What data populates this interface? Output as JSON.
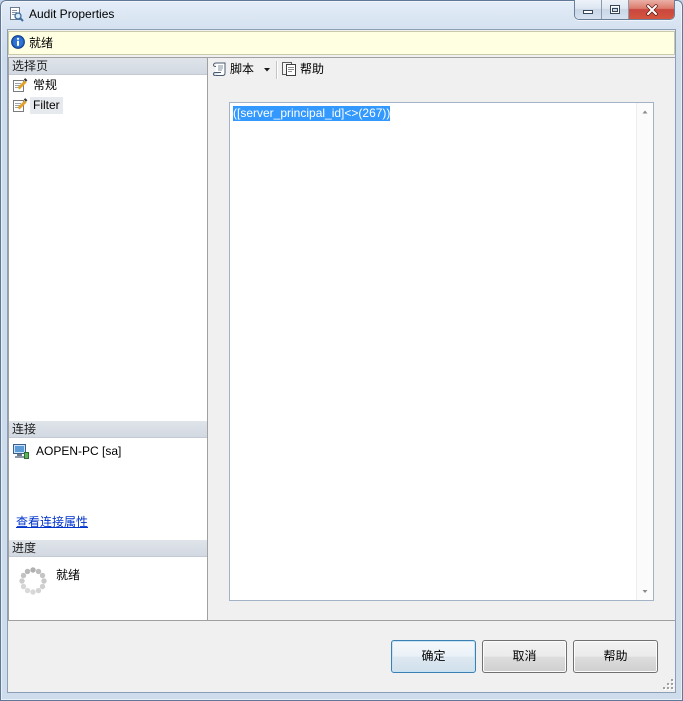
{
  "window": {
    "title": "Audit Properties",
    "icon": "audit-properties-icon",
    "controls": [
      "minimize-icon",
      "maximize-icon",
      "close-icon"
    ]
  },
  "status_bar": {
    "icon": "info-icon",
    "text": "就绪"
  },
  "sidebar": {
    "select_page": {
      "header": "选择页",
      "items": [
        {
          "label": "常规",
          "icon": "page-properties-icon",
          "selected": false
        },
        {
          "label": "Filter",
          "icon": "page-properties-icon",
          "selected": true
        }
      ]
    },
    "connection": {
      "header": "连接",
      "server": "AOPEN-PC [sa]",
      "icon": "server-connection-icon",
      "view_properties_link": "查看连接属性"
    },
    "progress": {
      "header": "进度",
      "status": "就绪",
      "icon": "loading-spinner-icon"
    }
  },
  "toolbar": {
    "script_label": "脚本",
    "script_icon": "script-icon",
    "script_dropdown_icon": "chevron-down-icon",
    "help_label": "帮助",
    "help_icon": "help-icon"
  },
  "editor": {
    "text": "([server_principal_id]<>(267))",
    "text_selected": true
  },
  "buttons": {
    "ok": "确定",
    "cancel": "取消",
    "help": "帮助"
  },
  "colors": {
    "frame": "#cfdceb",
    "client": "#f0f0f0",
    "status_bar": "#ffffe1",
    "section_header": "#d3d9e2",
    "selection": "#3399ff",
    "link": "#0033cc",
    "close_button": "#c9463d",
    "focus_border": "#3c7fb1"
  }
}
